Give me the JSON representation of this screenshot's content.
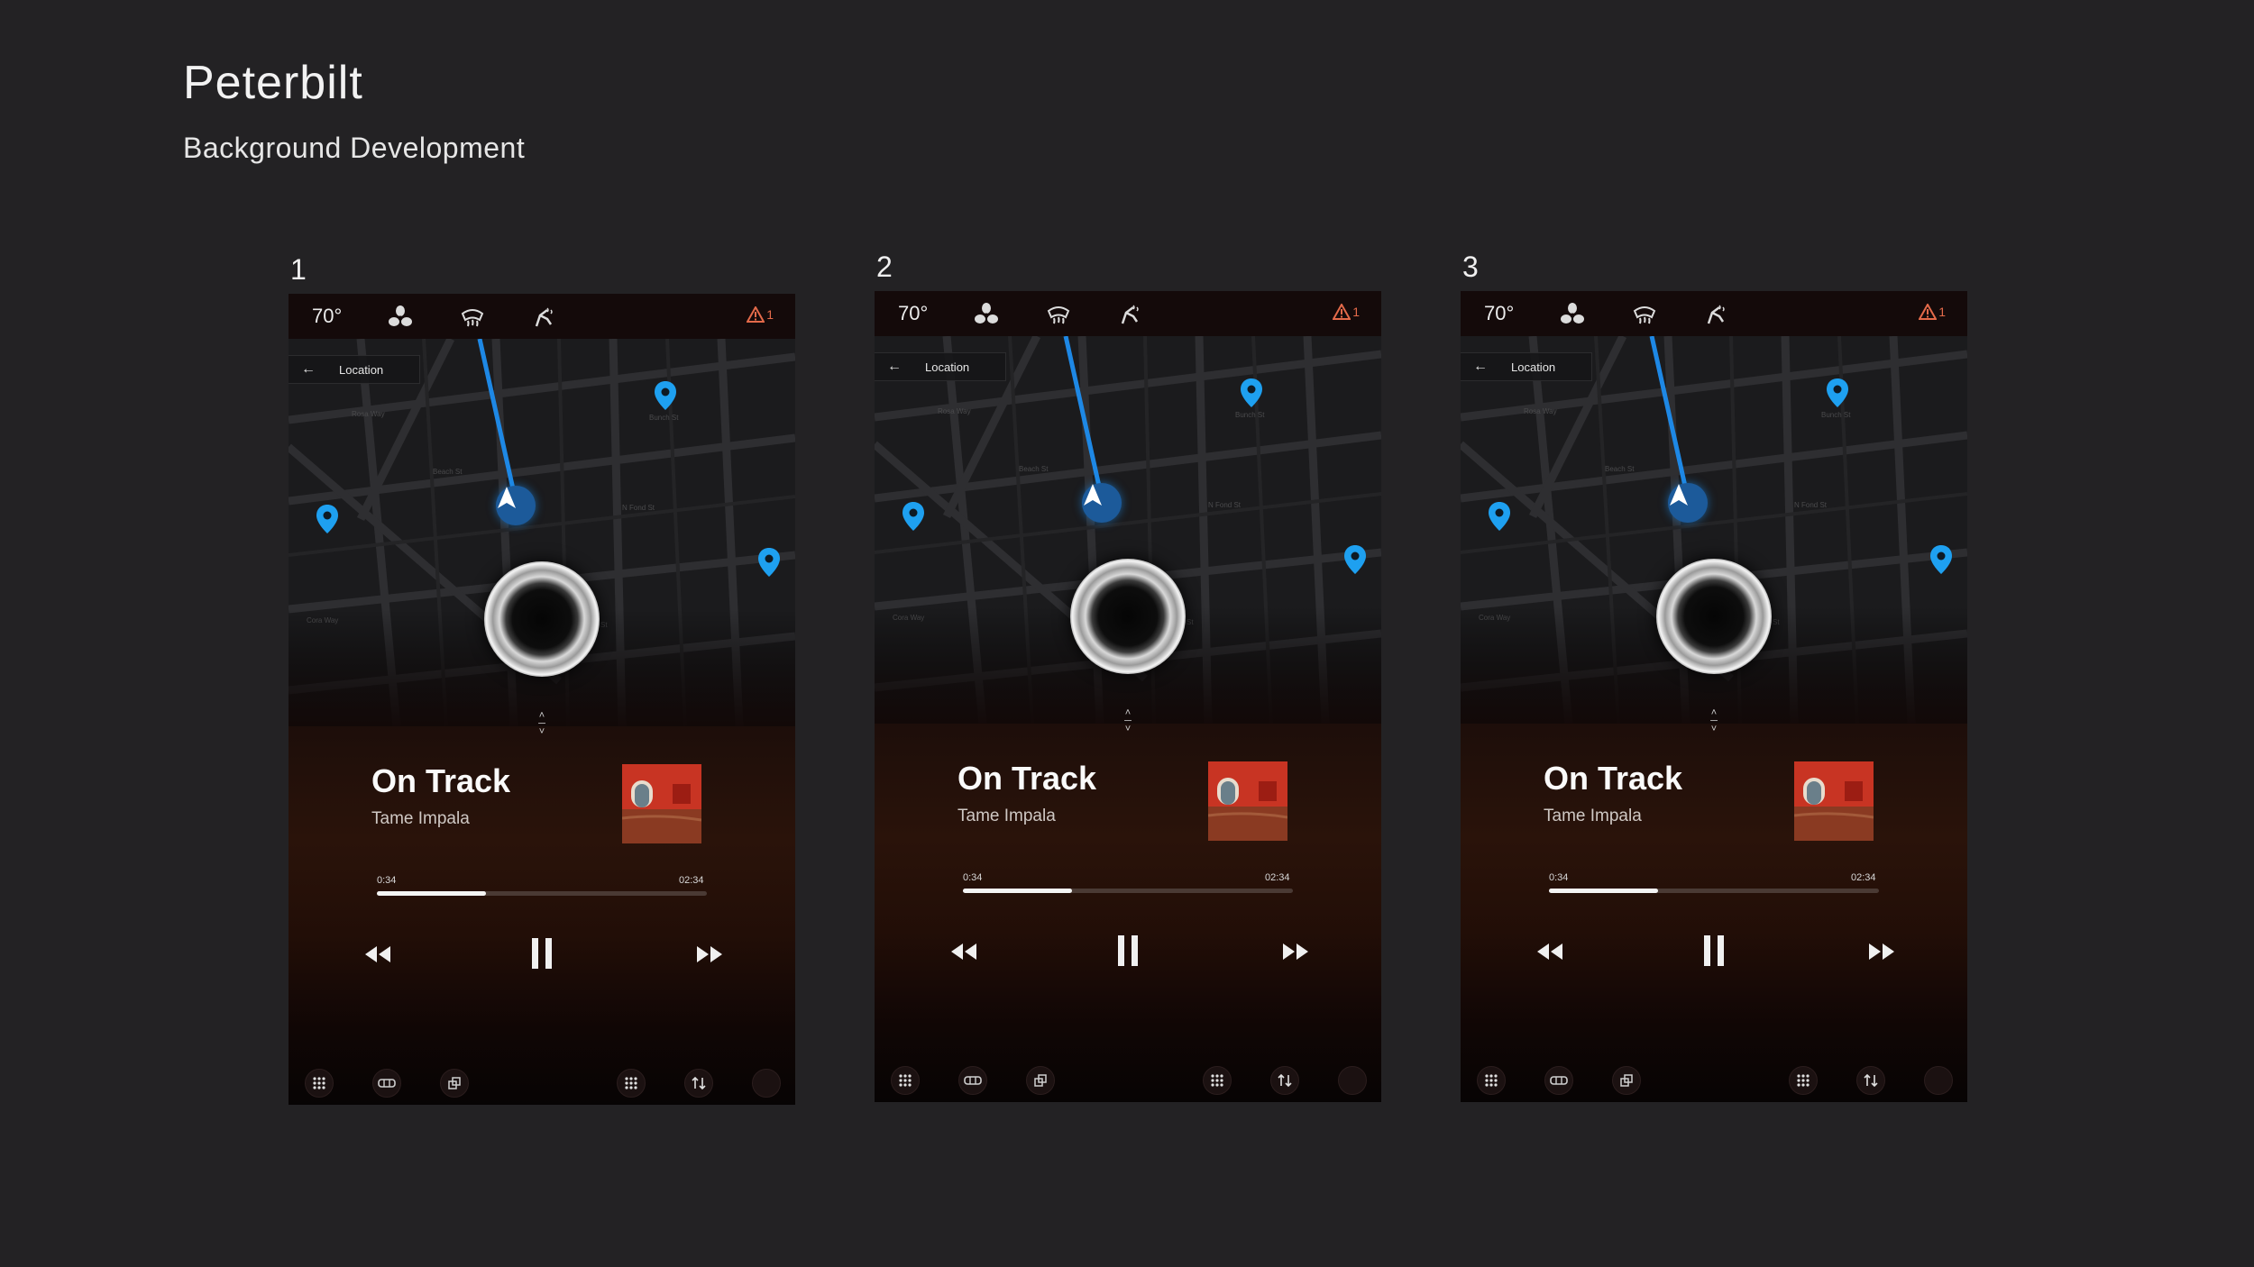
{
  "header": {
    "title": "Peterbilt",
    "subtitle": "Background Development"
  },
  "panels": [
    {
      "number": "1",
      "status": {
        "temperature": "70°",
        "alert_count": "1"
      },
      "location_button": "Location",
      "track": {
        "title": "On Track",
        "artist": "Tame Impala",
        "elapsed": "0:34",
        "duration": "02:34",
        "progress": 0.33
      }
    },
    {
      "number": "2",
      "status": {
        "temperature": "70°",
        "alert_count": "1"
      },
      "location_button": "Location",
      "track": {
        "title": "On Track",
        "artist": "Tame Impala",
        "elapsed": "0:34",
        "duration": "02:34",
        "progress": 0.33
      }
    },
    {
      "number": "3",
      "status": {
        "temperature": "70°",
        "alert_count": "1"
      },
      "location_button": "Location",
      "track": {
        "title": "On Track",
        "artist": "Tame Impala",
        "elapsed": "0:34",
        "duration": "02:34",
        "progress": 0.33
      }
    }
  ],
  "icons": {
    "status_bar": [
      "fan-icon",
      "defrost-icon",
      "seat-heat-icon",
      "warning-icon"
    ],
    "transport": [
      "rewind-icon",
      "pause-icon",
      "fast-forward-icon"
    ],
    "dock": [
      "apps-grid-icon",
      "vehicle-icon",
      "copy-icon",
      "apps-grid-icon",
      "sort-icon",
      "circle-icon"
    ]
  },
  "colors": {
    "background": "#232224",
    "route_blue": "#1e88e5",
    "pin_blue": "#1ea0f0",
    "alert": "#e36a4a"
  }
}
